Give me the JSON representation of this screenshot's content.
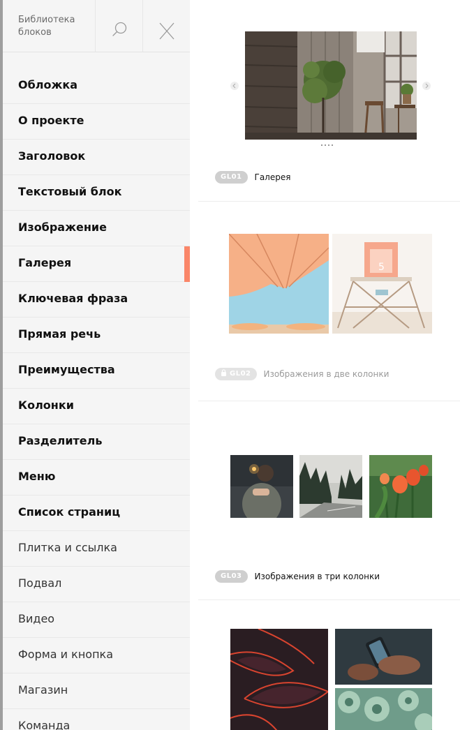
{
  "sidebar": {
    "title": "Библиотека блоков",
    "search_icon": "search-icon",
    "close_icon": "close-icon",
    "items": [
      {
        "label": "Обложка",
        "weight": "bold"
      },
      {
        "label": "О проекте",
        "weight": "bold"
      },
      {
        "label": "Заголовок",
        "weight": "bold"
      },
      {
        "label": "Текстовый блок",
        "weight": "bold"
      },
      {
        "label": "Изображение",
        "weight": "bold"
      },
      {
        "label": "Галерея",
        "weight": "bold",
        "active": true
      },
      {
        "label": "Ключевая фраза",
        "weight": "bold"
      },
      {
        "label": "Прямая речь",
        "weight": "bold"
      },
      {
        "label": "Преимущества",
        "weight": "bold"
      },
      {
        "label": "Колонки",
        "weight": "bold"
      },
      {
        "label": "Разделитель",
        "weight": "bold"
      },
      {
        "label": "Меню",
        "weight": "bold"
      },
      {
        "label": "Список страниц",
        "weight": "bold"
      },
      {
        "label": "Плитка и ссылка",
        "weight": "normal"
      },
      {
        "label": "Подвал",
        "weight": "normal"
      },
      {
        "label": "Видео",
        "weight": "normal"
      },
      {
        "label": "Форма и кнопка",
        "weight": "normal"
      },
      {
        "label": "Магазин",
        "weight": "normal"
      },
      {
        "label": "Команда",
        "weight": "normal"
      }
    ],
    "active_color": "#fa8669"
  },
  "blocks": [
    {
      "code": "GL01",
      "name": "Галерея",
      "locked": false
    },
    {
      "code": "GL02",
      "name": "Изображения в две колонки",
      "locked": true
    },
    {
      "code": "GL03",
      "name": "Изображения в три колонки",
      "locked": false
    }
  ]
}
